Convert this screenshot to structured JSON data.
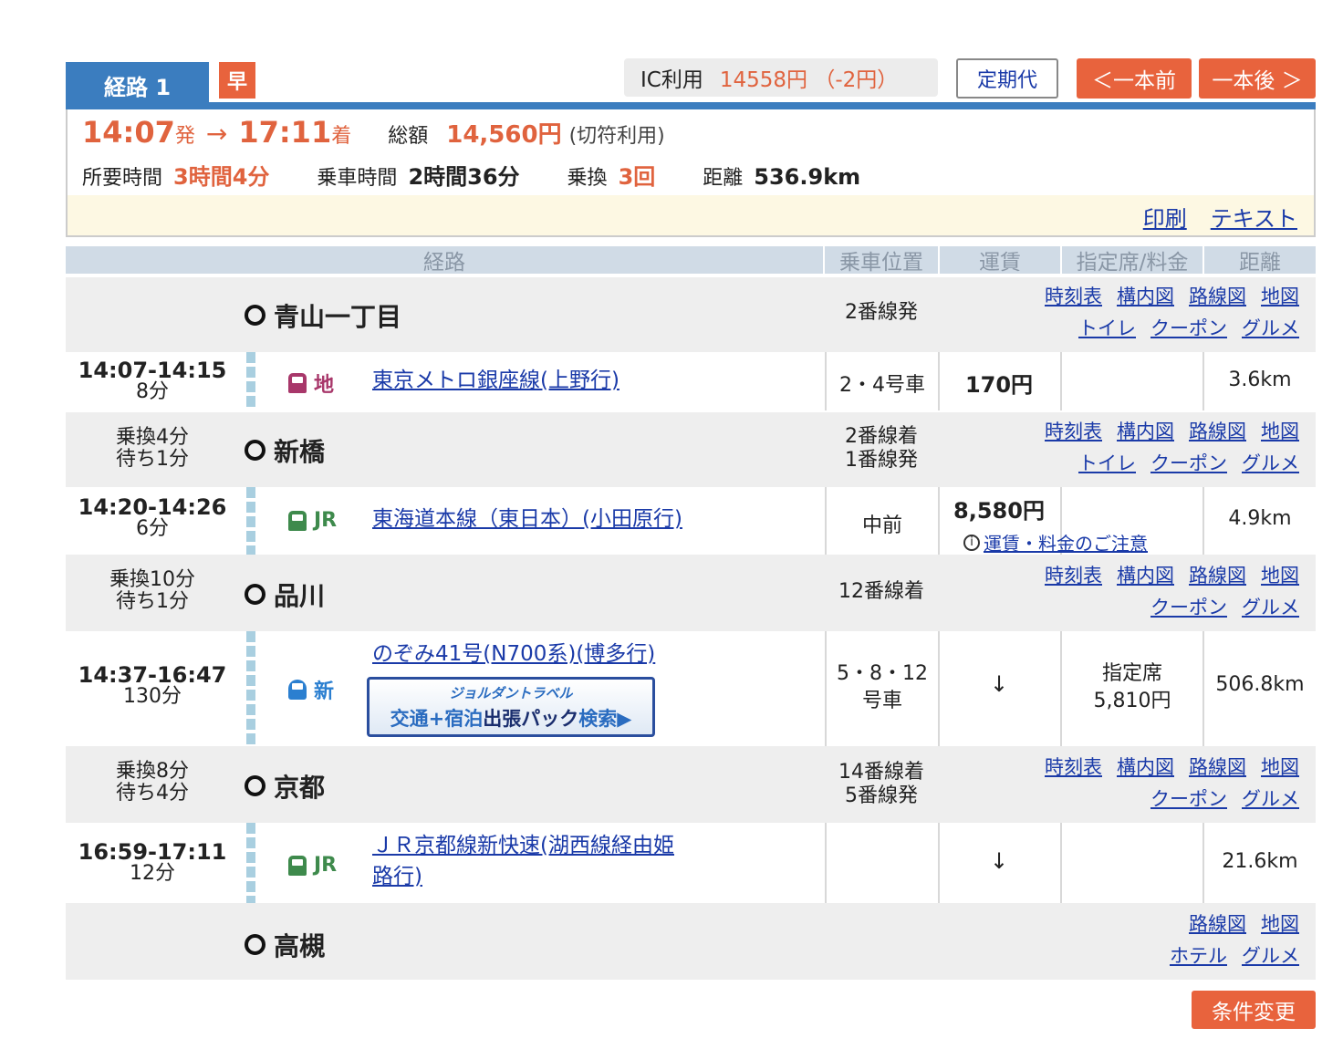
{
  "header": {
    "route_tab": "経路 1",
    "early_badge": "早",
    "ic_label": "IC利用",
    "ic_value": "14558円 （-2円）",
    "commuter_button": "定期代",
    "prev_button": "＜一本前",
    "next_button": "一本後 ＞"
  },
  "summary": {
    "depart_time": "14:07",
    "depart_suffix": "発",
    "arrow": "→",
    "arrive_time": "17:11",
    "arrive_suffix": "着",
    "total_label": "総額",
    "total_value": "14,560円",
    "total_note": "(切符利用)",
    "duration_label": "所要時間",
    "duration_value": "3時間4分",
    "ride_label": "乗車時間",
    "ride_value": "2時間36分",
    "transfer_label": "乗換",
    "transfer_value": "3回",
    "distance_label": "距離",
    "distance_value": "536.9km",
    "print_link": "印刷",
    "text_link": "テキスト"
  },
  "table_headers": [
    "経路",
    "乗車位置",
    "運賃",
    "指定席/料金",
    "距離"
  ],
  "stations": [
    {
      "name": "青山一丁目",
      "platform": "2番線発",
      "transfer": "",
      "wait": "",
      "links_row1": [
        "時刻表",
        "構内図",
        "路線図",
        "地図"
      ],
      "links_row2": [
        "トイレ",
        "クーポン",
        "グルメ"
      ]
    },
    {
      "name": "新橋",
      "platform": "2番線着",
      "platform2": "1番線発",
      "transfer": "乗換4分",
      "wait": "待ち1分",
      "links_row1": [
        "時刻表",
        "構内図",
        "路線図",
        "地図"
      ],
      "links_row2": [
        "トイレ",
        "クーポン",
        "グルメ"
      ]
    },
    {
      "name": "品川",
      "platform": "12番線着",
      "transfer": "乗換10分",
      "wait": "待ち1分",
      "links_row1": [
        "時刻表",
        "構内図",
        "路線図",
        "地図"
      ],
      "links_row2": [
        "クーポン",
        "グルメ"
      ]
    },
    {
      "name": "京都",
      "platform": "14番線着",
      "platform2": "5番線発",
      "transfer": "乗換8分",
      "wait": "待ち4分",
      "links_row1": [
        "時刻表",
        "構内図",
        "路線図",
        "地図"
      ],
      "links_row2": [
        "クーポン",
        "グルメ"
      ]
    },
    {
      "name": "高槻",
      "platform": "",
      "transfer": "",
      "wait": "",
      "links_row1": [
        "路線図",
        "地図"
      ],
      "links_row2": [
        "ホテル",
        "グルメ"
      ]
    }
  ],
  "segments": [
    {
      "time": "14:07-14:15",
      "duration": "8分",
      "type_label": "地",
      "type_color": "#a8376a",
      "line": "東京メトロ銀座線(上野行)",
      "position": "2・4号車",
      "fare": "170円",
      "seat": "",
      "distance": "3.6km"
    },
    {
      "time": "14:20-14:26",
      "duration": "6分",
      "type_label": "JR",
      "type_color": "#3e8a4c",
      "line": "東海道本線（東日本）(小田原行)",
      "position": "中前",
      "fare": "8,580円",
      "fare_note": "運賃・料金のご注意",
      "seat": "",
      "distance": "4.9km"
    },
    {
      "time": "14:37-16:47",
      "duration": "130分",
      "type_label": "新",
      "type_color": "#2b7fd0",
      "line": "のぞみ41号(N700系)(博多行)",
      "position": "5・8・12",
      "position2": "号車",
      "fare": "↓",
      "seat": "指定席",
      "seat2": "5,810円",
      "distance": "506.8km",
      "banner_line1": "ジョルダントラベル",
      "banner_line2a": "交通+宿泊",
      "banner_line2b": "出張パック",
      "banner_line2c": "検索▶"
    },
    {
      "time": "16:59-17:11",
      "duration": "12分",
      "type_label": "JR",
      "type_color": "#3e8a4c",
      "line": "ＪＲ京都線新快速(湖西線経由姫",
      "line2": "路行)",
      "position": "",
      "fare": "↓",
      "seat": "",
      "distance": "21.6km"
    }
  ],
  "footer": {
    "condition_button": "条件変更"
  },
  "colors": {
    "accent_orange": "#e8633d",
    "header_blue": "#3b7dbf",
    "link_blue": "#1a3aa8"
  }
}
